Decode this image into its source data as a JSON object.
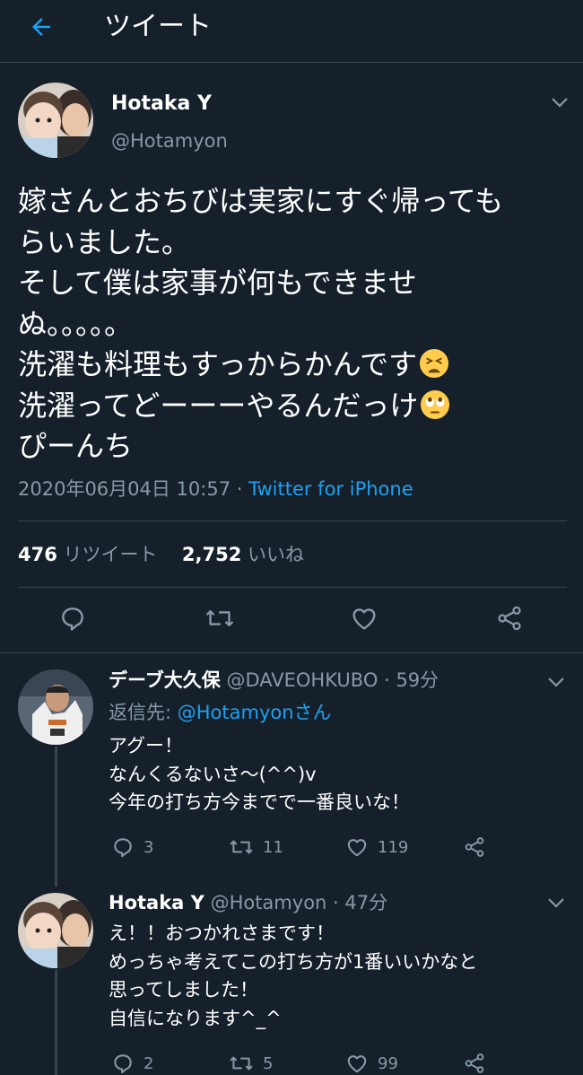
{
  "header": {
    "title": "ツイート"
  },
  "tweet": {
    "author_name": "Hotaka Y",
    "author_handle": "@Hotamyon",
    "lines": [
      "嫁さんとおちびは実家にすぐ帰ってもらいました。"
    ],
    "line1": "嫁さんとおちびは実家にすぐ帰っても",
    "line2": "らいました。",
    "line3": "そして僕は家事が何もできませ",
    "line4": "ぬ。。。。。",
    "line5": "洗濯も料理もすっからかんです",
    "line6": "洗濯ってどーーーやるんだっけ",
    "line7": "ぴーんち",
    "emoji_tired": "tired-face-emoji",
    "emoji_eyeroll": "rolling-eyes-emoji",
    "timestamp": "2020年06月04日 10:57",
    "via_sep": " · ",
    "via": "Twitter for iPhone",
    "retweet_count": "476",
    "retweet_label": "リツイート",
    "like_count": "2,752",
    "like_label": "いいね"
  },
  "replies": [
    {
      "name": "デーブ大久保",
      "handle": "@DAVEOHKUBO",
      "time": "59分",
      "reply_to_label": "返信先:",
      "reply_to": "@Hotamyonさん",
      "lines": [
        "アグー！",
        "なんくるないさ〜(^^)v",
        "今年の打ち方今までで一番良いな！"
      ],
      "reply_count": "3",
      "retweet_count": "11",
      "like_count": "119"
    },
    {
      "name": "Hotaka Y",
      "handle": "@Hotamyon",
      "time": "47分",
      "lines": [
        "え！！おつかれさまです！",
        "めっちゃ考えてこの打ち方が1番いいかなと",
        "思ってしました！",
        "自信になります^_^"
      ],
      "reply_count": "2",
      "retweet_count": "5",
      "like_count": "99"
    }
  ],
  "colors": {
    "background": "#15202b",
    "accent": "#1da1f2",
    "secondary_text": "#8899a6",
    "divider": "#38444d"
  },
  "icons": [
    "back-arrow-icon",
    "chevron-down-icon",
    "reply-icon",
    "retweet-icon",
    "like-icon",
    "share-icon"
  ]
}
